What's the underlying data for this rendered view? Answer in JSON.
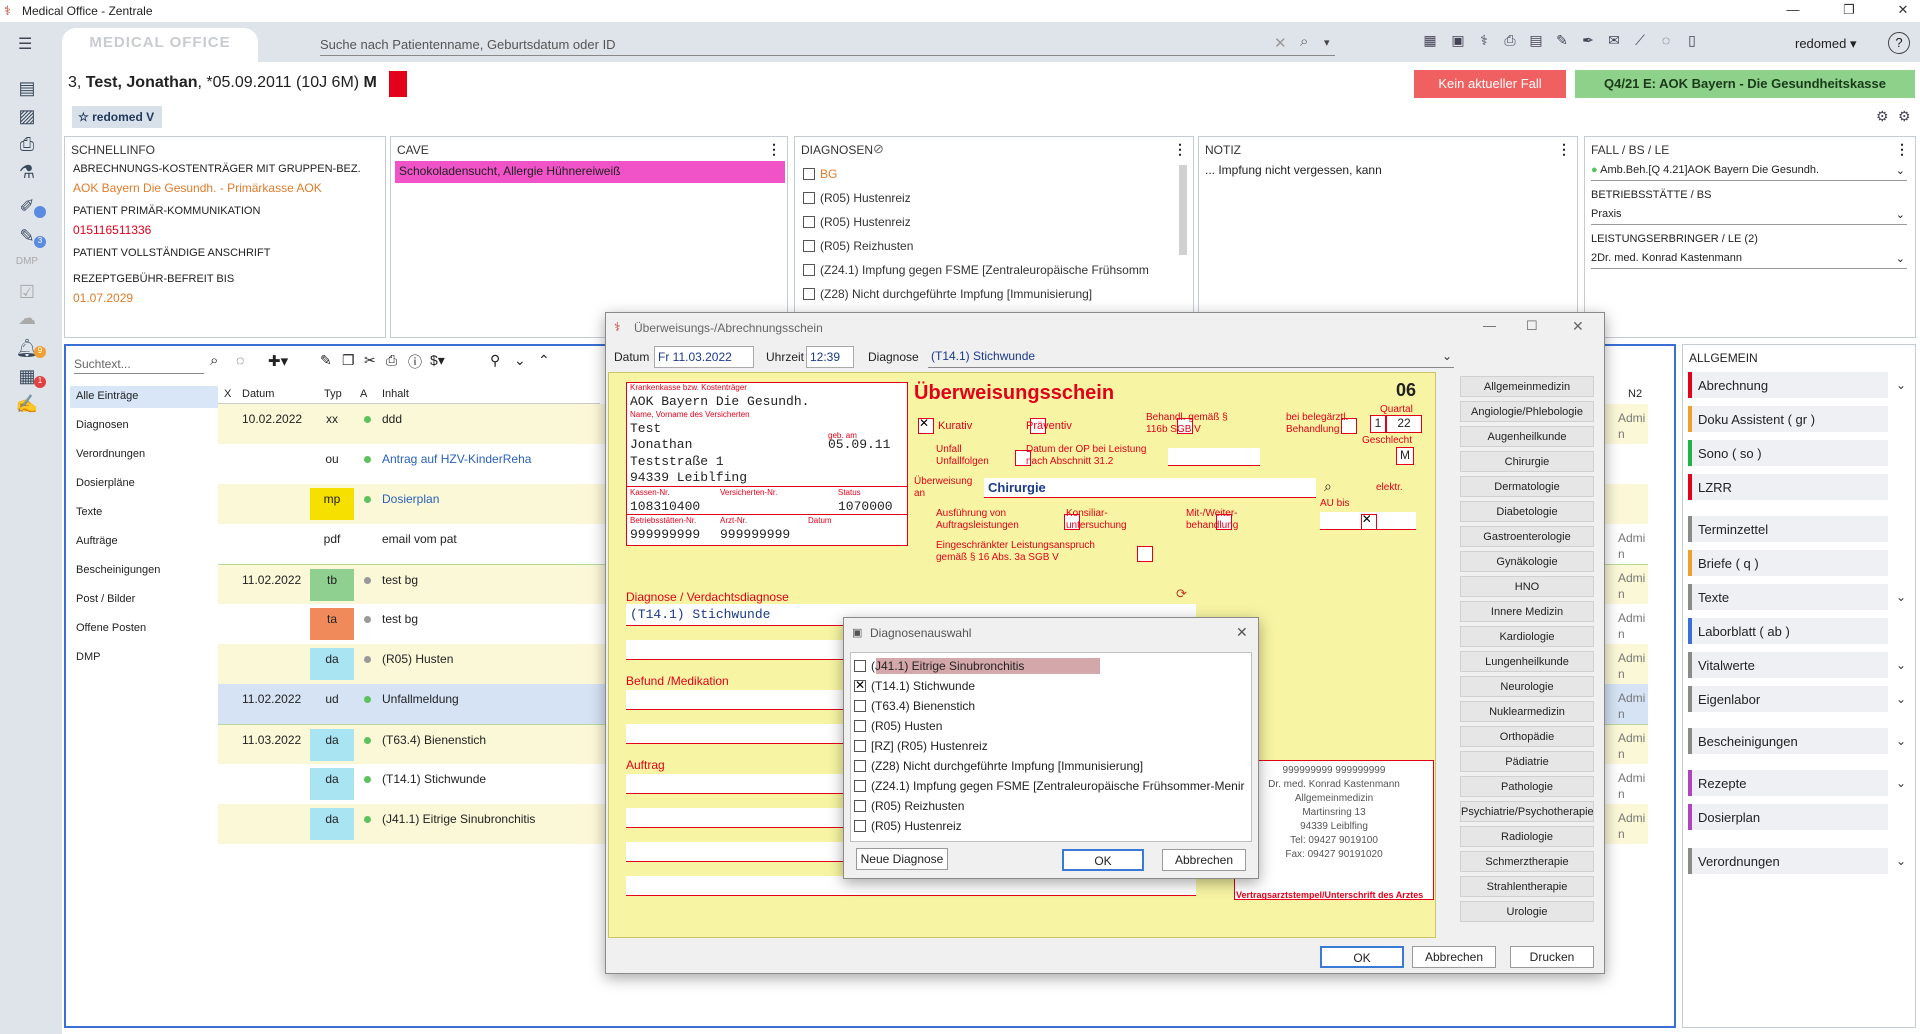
{
  "window": {
    "title": "Medical Office - Zentrale"
  },
  "topbar": {
    "logo": "MEDICAL OFFICE",
    "search_placeholder": "Suche nach Patientenname, Geburtsdatum oder ID",
    "user": "redomed"
  },
  "patient": {
    "number": "3,",
    "name": "Test, Jonathan",
    "birth": ", *05.09.2011 (10J 6M)",
    "sex": "M",
    "flag_color": "#e3001b",
    "badge": "redomed V",
    "fall_button": "Kein aktueller Fall",
    "quarter_button": "Q4/21 E: AOK Bayern - Die Gesundheitskasse"
  },
  "schnellinfo": {
    "header": "SCHNELLINFO",
    "items": [
      {
        "label": "ABRECHNUNGS-KOSTENTRÄGER MIT GRUPPEN-BEZ.",
        "value": "AOK Bayern Die Gesundh. - Primärkasse AOK"
      },
      {
        "label": "PATIENT PRIMÄR-KOMMUNIKATION",
        "value": "015116511336"
      },
      {
        "label": "PATIENT VOLLSTÄNDIGE ANSCHRIFT",
        "value": ""
      },
      {
        "label": "REZEPTGEBÜHR-BEFREIT BIS",
        "value": "01.07.2029"
      }
    ]
  },
  "cave": {
    "header": "CAVE",
    "text": "Schokoladensucht, Allergie Hühnereiweiß"
  },
  "diagnosen": {
    "header": "DIAGNOSEN",
    "items": [
      "BG",
      "(R05) Hustenreiz",
      "(R05) Hustenreiz",
      "(R05) Reizhusten",
      "(Z24.1) Impfung gegen FSME [Zentraleuropäische Frühsomm",
      "(Z28) Nicht durchgeführte Impfung [Immunisierung]"
    ]
  },
  "notiz": {
    "header": "NOTIZ",
    "text": "... Impfung nicht vergessen, kann"
  },
  "fall": {
    "header": "FALL / BS / LE",
    "fall_value": "Amb.Beh.[Q 4.21]AOK Bayern Die Gesundh.",
    "bs_label": "BETRIEBSSTÄTTE / BS",
    "bs_value": "Praxis",
    "le_label": "LEISTUNGSERBRINGER / LE (2)",
    "le_value": "2Dr. med. Konrad Kastenmann"
  },
  "list": {
    "search_placeholder": "Suchtext...",
    "filters": [
      "Alle Einträge",
      "Diagnosen",
      "Verordnungen",
      "Dosierpläne",
      "Texte",
      "Aufträge",
      "Bescheinigungen",
      "Post / Bilder",
      "Offene Posten",
      "DMP"
    ],
    "columns": {
      "x": "X",
      "date": "Datum",
      "type": "Typ",
      "a": "A",
      "content": "Inhalt",
      "n2": "N2"
    },
    "rows": [
      {
        "date": "10.02.2022",
        "type": "xx",
        "text": "ddd",
        "admi": "Admi n"
      },
      {
        "date": "",
        "type": "ou",
        "text": "Antrag auf HZV-KinderReha",
        "admi": ""
      },
      {
        "date": "",
        "type": "mp",
        "text": "Dosierplan",
        "admi": ""
      },
      {
        "date": "",
        "type": "pdf",
        "text": "email vom pat",
        "admi": "Admi n"
      },
      {
        "date": "11.02.2022",
        "type": "tb",
        "text": "test bg",
        "admi": "Admi n"
      },
      {
        "date": "",
        "type": "ta",
        "text": "test bg",
        "admi": "Admi n"
      },
      {
        "date": "",
        "type": "da",
        "text": "(R05) Husten",
        "admi": "Admi n"
      },
      {
        "date": "11.02.2022",
        "type": "ud",
        "text": "Unfallmeldung",
        "admi": "Admi n"
      },
      {
        "date": "11.03.2022",
        "type": "da",
        "text": "(T63.4) Bienenstich",
        "admi": "Admi n"
      },
      {
        "date": "",
        "type": "da",
        "text": "(T14.1) Stichwunde",
        "admi": "Admi n"
      },
      {
        "date": "",
        "type": "da",
        "text": "(J41.1) Eitrige Sinubronchitis",
        "admi": "Admi n"
      }
    ]
  },
  "rightpanel": {
    "header": "ALLGEMEIN",
    "items": [
      {
        "label": "Abrechnung",
        "color": "#e3001b"
      },
      {
        "label": "Doku Assistent ( gr )",
        "color": "#f0a030"
      },
      {
        "label": "Sono ( so )",
        "color": "#22b14c"
      },
      {
        "label": "LZRR",
        "color": "#e3001b"
      },
      {
        "label": "Terminzettel",
        "color": "#8a8a8a"
      },
      {
        "label": "Briefe ( q )",
        "color": "#f0a030"
      },
      {
        "label": "Texte",
        "color": "#8a8a8a"
      },
      {
        "label": "Laborblatt ( ab )",
        "color": "#3a6fd6"
      },
      {
        "label": "Vitalwerte",
        "color": "#8a8a8a"
      },
      {
        "label": "Eigenlabor",
        "color": "#8a8a8a"
      },
      {
        "label": "Bescheinigungen",
        "color": "#8a8a8a"
      },
      {
        "label": "Rezepte",
        "color": "#b044c0"
      },
      {
        "label": "Dosierplan",
        "color": "#b044c0"
      },
      {
        "label": "Verordnungen",
        "color": "#8a8a8a"
      }
    ]
  },
  "dialog": {
    "title": "Überweisungs-/Abrechnungsschein",
    "datum_label": "Datum",
    "datum_value": "Fr 11.03.2022",
    "uhrzeit_label": "Uhrzeit",
    "uhrzeit_value": "12:39",
    "diagnose_label": "Diagnose",
    "diagnose_value": "(T14.1) Stichwunde",
    "form": {
      "kasse_label": "Krankenkasse bzw. Kostenträger",
      "kasse": "AOK Bayern Die Gesundh.",
      "name_label": "Name, Vorname des Versicherten",
      "geb_label": "geb. am",
      "name": "Test",
      "vorname": "Jonathan",
      "street": "Teststraße 1",
      "city": "94339 Leiblfing",
      "geb": "05.09.11",
      "kassennr_label": "Kassen-Nr.",
      "versnr_label": "Versicherten-Nr.",
      "status_label": "Status",
      "kassennr": "108310400",
      "status": "1070000",
      "bsnr_label": "Betriebsstätten-Nr.",
      "lanr_label": "Arzt-Nr.",
      "datum_label": "Datum",
      "bsnr": "999999999",
      "lanr": "999999999",
      "title": "Überweisungsschein",
      "number": "06",
      "quartal_label": "Quartal",
      "quartal_a": "1",
      "quartal_b": "22",
      "geschlecht_label": "Geschlecht",
      "geschlecht": "M",
      "kurativ": "Kurativ",
      "praeventiv": "Präventiv",
      "behandl": "Behandl. gemäß § 116b SGB V",
      "belegarzt": "bei belegärztl. Behandlung",
      "unfall": "Unfall Unfallfolgen",
      "op_label": "Datum der OP bei Leistung nach Abschnitt 31.2",
      "ueberweisung_label": "Überweisung an",
      "ueberweisung_value": "Chirurgie",
      "elektr": "elektr.",
      "au_label": "AU bis",
      "ausfuehrung": "Ausführung von Auftragsleistungen",
      "konsiliar": "Konsiliar-untersuchung",
      "mitweiter": "Mit-/Weiter-behandlung",
      "eingeschraenkt": "Eingeschränkter Leistungsanspruch gemäß § 16 Abs. 3a SGB V",
      "diag_label": "Diagnose / Verdachtsdiagnose",
      "diag_value": "(T14.1) Stichwunde",
      "befund_label": "Befund /Medikation",
      "auftrag_label": "Auftrag",
      "stamp": [
        "999999999 999999999",
        "Dr. med. Konrad Kastenmann",
        "Allgemeinmedizin",
        "Martinsring 13",
        "94339 Leiblfing",
        "Tel: 09427 9019100",
        "Fax: 09427 90191020"
      ],
      "stamp_label": "Vertragsarztstempel/Unterschrift des Arztes"
    },
    "specialties": [
      "Allgemeinmedizin",
      "Angiologie/Phlebologie",
      "Augenheilkunde",
      "Chirurgie",
      "Dermatologie",
      "Diabetologie",
      "Gastroenterologie",
      "Gynäkologie",
      "HNO",
      "Innere Medizin",
      "Kardiologie",
      "Lungenheilkunde",
      "Neurologie",
      "Nuklearmedizin",
      "Orthopädie",
      "Pädiatrie",
      "Pathologie",
      "Psychiatrie/Psychotherapie",
      "Radiologie",
      "Schmerztherapie",
      "Strahlentherapie",
      "Urologie"
    ],
    "ok": "OK",
    "cancel": "Abbrechen",
    "print": "Drucken"
  },
  "subdialog": {
    "title": "Diagnosenauswahl",
    "items": [
      {
        "label": "(J41.1) Eitrige Sinubronchitis",
        "checked": false
      },
      {
        "label": "(T14.1) Stichwunde",
        "checked": true
      },
      {
        "label": "(T63.4) Bienenstich",
        "checked": false
      },
      {
        "label": "(R05) Husten",
        "checked": false
      },
      {
        "label": "[RZ] (R05) Hustenreiz",
        "checked": false
      },
      {
        "label": "(Z28) Nicht durchgeführte Impfung [Immunisierung]",
        "checked": false
      },
      {
        "label": "(Z24.1) Impfung gegen FSME [Zentraleuropäische Frühsommer-Menir",
        "checked": false
      },
      {
        "label": "(R05) Reizhusten",
        "checked": false
      },
      {
        "label": "(R05) Hustenreiz",
        "checked": false
      }
    ],
    "new_button": "Neue Diagnose",
    "ok": "OK",
    "cancel": "Abbrechen"
  }
}
